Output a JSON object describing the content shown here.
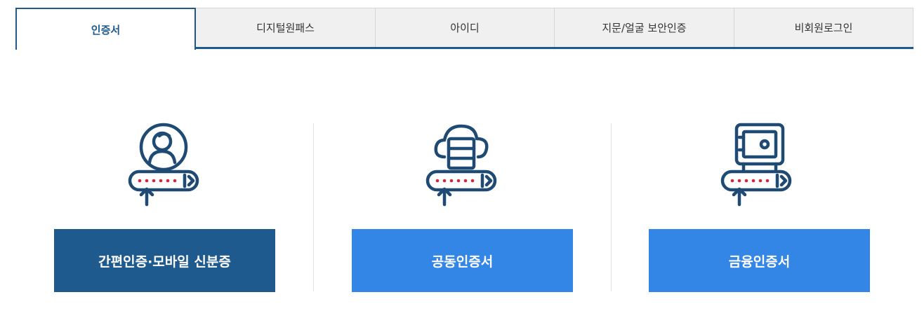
{
  "tabs": [
    {
      "label": "인증서",
      "active": true
    },
    {
      "label": "디지털원패스",
      "active": false
    },
    {
      "label": "아이디",
      "active": false
    },
    {
      "label": "지문/얼굴 보안인증",
      "active": false
    },
    {
      "label": "비회원로그인",
      "active": false
    }
  ],
  "methods": [
    {
      "label": "간편인증·모바일 신분증",
      "icon": "user-password-icon"
    },
    {
      "label": "공동인증서",
      "icon": "cloud-server-password-icon"
    },
    {
      "label": "금융인증서",
      "icon": "safe-password-icon"
    }
  ],
  "colors": {
    "navy": "#1e5a8e",
    "blue": "#3385e6",
    "accent_red": "#d6263e"
  }
}
